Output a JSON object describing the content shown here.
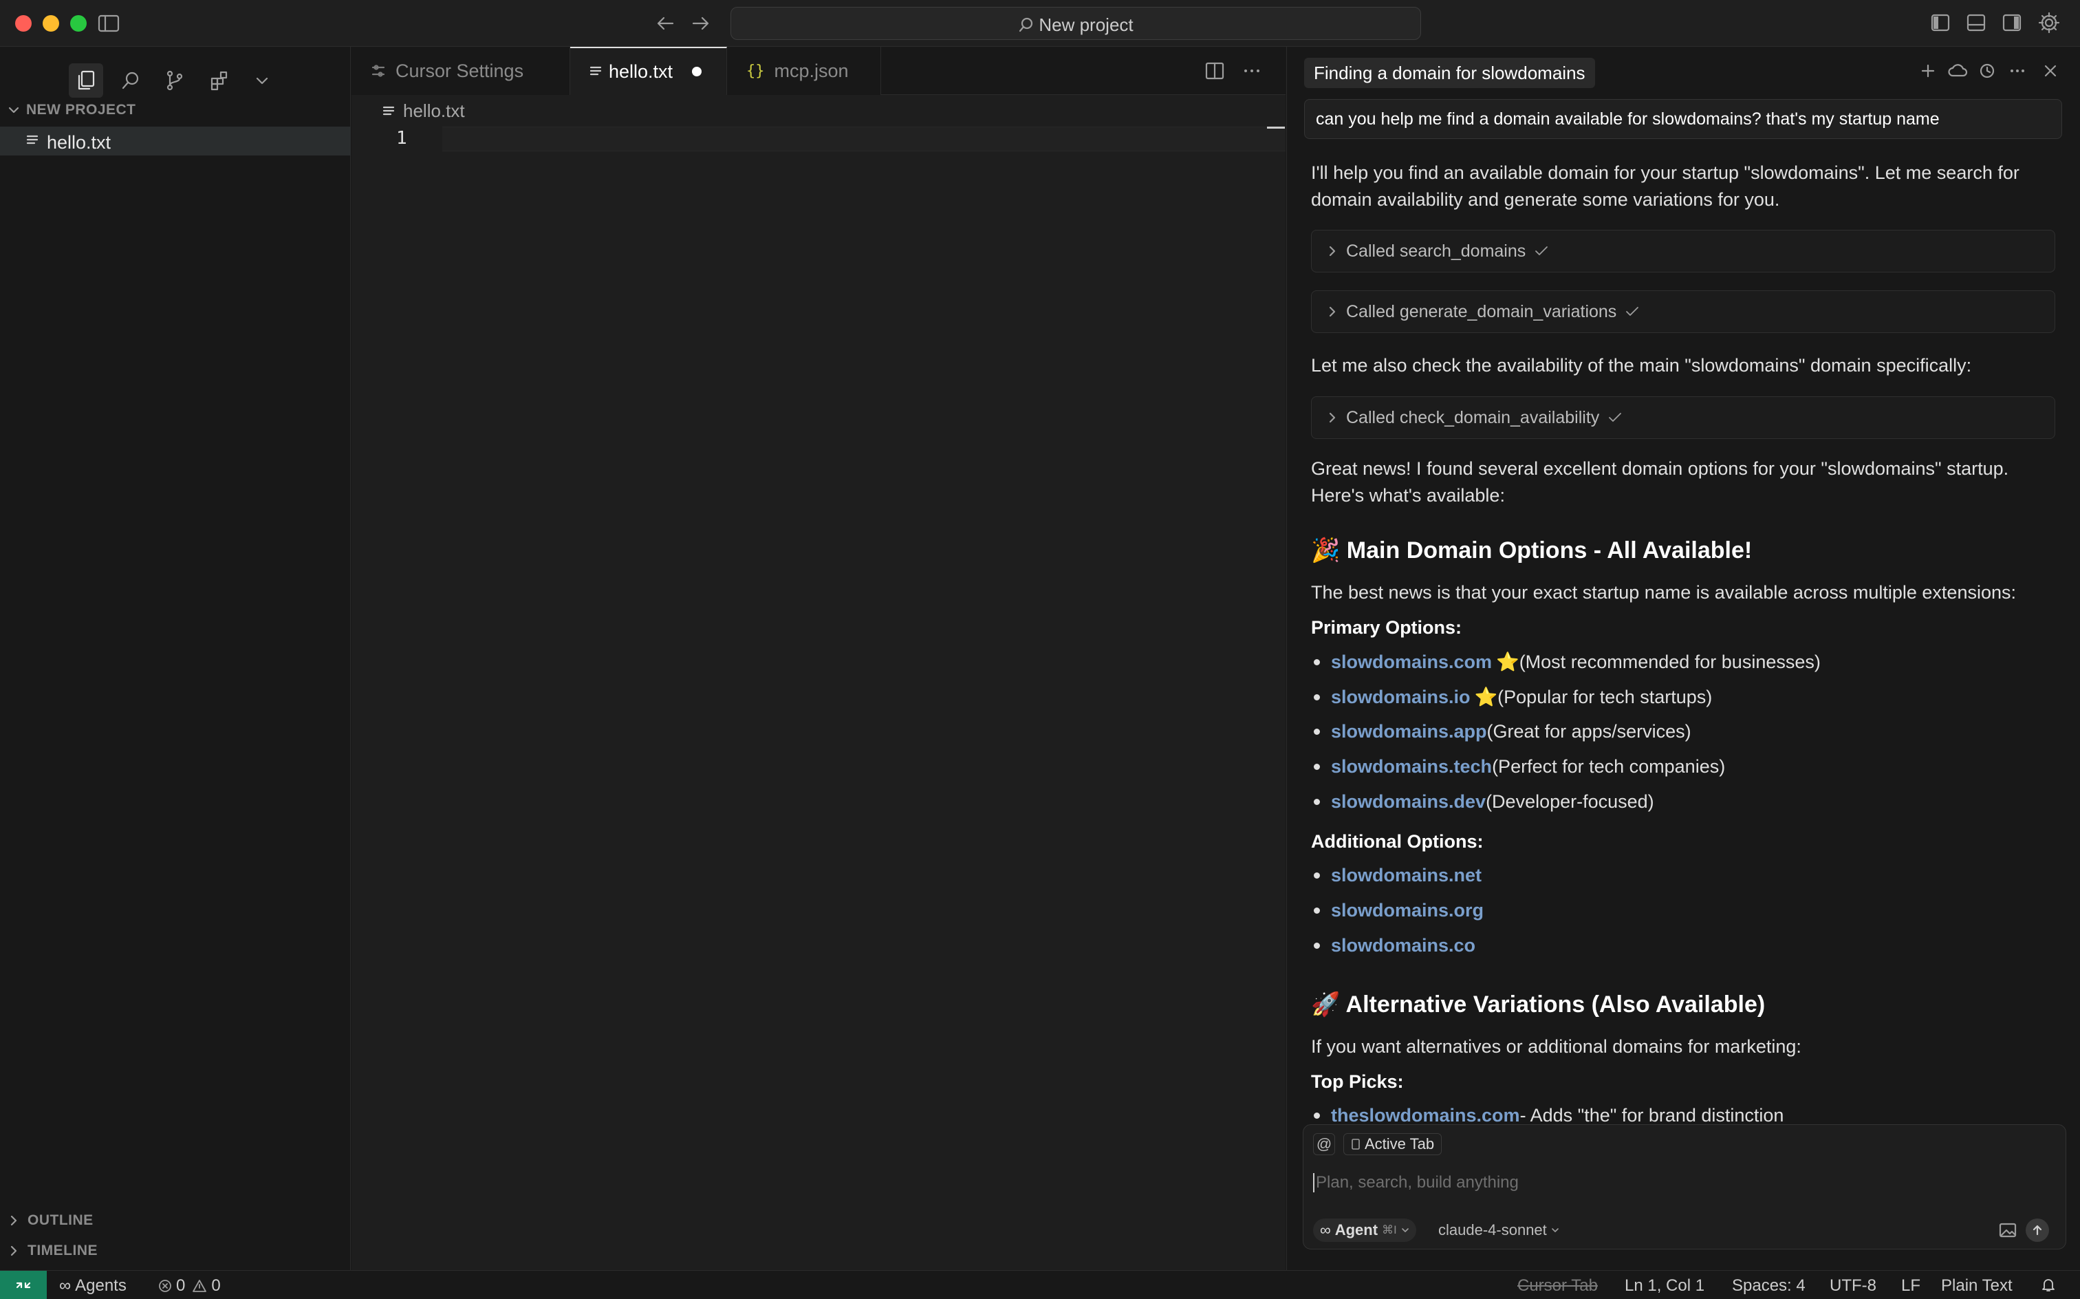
{
  "window": {
    "title": "New project"
  },
  "colors": {
    "accent": "#3794ff",
    "link": "#7a9fcc",
    "close": "#ff5f57",
    "minimize": "#febc2e",
    "zoom": "#28c840",
    "remote": "#16825d"
  },
  "sidebar": {
    "section_title": "NEW PROJECT",
    "files": [
      "hello.txt"
    ],
    "outline_label": "OUTLINE",
    "timeline_label": "TIMELINE"
  },
  "editor": {
    "tabs": [
      {
        "label": "Cursor Settings"
      },
      {
        "label": "hello.txt"
      },
      {
        "label": "mcp.json"
      }
    ],
    "breadcrumb": "hello.txt",
    "line_number": "1"
  },
  "agent": {
    "header_title": "Finding a domain for slowdomains",
    "user_message": "can you help me find a domain available for slowdomains? that's my startup name",
    "intro": "I'll help you find an available domain for your startup \"slowdomains\". Let me search for domain availability and generate some variations for you.",
    "calls": [
      "Called search_domains",
      "Called generate_domain_variations",
      "Called check_domain_availability"
    ],
    "check_main": "Let me also check the availability of the main \"slowdomains\" domain specifically:",
    "great_news": "Great news! I found several excellent domain options for your \"slowdomains\" startup. Here's what's available:",
    "heading_main": {
      "emoji": "🎉",
      "text": "Main Domain Options - All Available!"
    },
    "best_news": "The best news is that your exact startup name is available across multiple extensions:",
    "primary_label": "Primary Options:",
    "primary": [
      {
        "domain": "slowdomains.com",
        "star": "⭐",
        "note": " (Most recommended for businesses)"
      },
      {
        "domain": "slowdomains.io",
        "star": "⭐",
        "note": " (Popular for tech startups)"
      },
      {
        "domain": "slowdomains.app",
        "star": "",
        "note": " (Great for apps/services)"
      },
      {
        "domain": "slowdomains.tech",
        "star": "",
        "note": " (Perfect for tech companies)"
      },
      {
        "domain": "slowdomains.dev",
        "star": "",
        "note": " (Developer-focused)"
      }
    ],
    "additional_label": "Additional Options:",
    "additional": [
      "slowdomains.net",
      "slowdomains.org",
      "slowdomains.co"
    ],
    "heading_alt": {
      "emoji": "🚀",
      "text": "Alternative Variations (Also Available)"
    },
    "alt_intro": "If you want alternatives or additional domains for marketing:",
    "top_picks_label": "Top Picks:",
    "top_pick": {
      "domain": "theslowdomains.com",
      "note": " - Adds \"the\" for brand distinction"
    },
    "composer": {
      "at_symbol": "@",
      "context_chip": "Active Tab",
      "placeholder": "Plan, search, build anything",
      "mode_label": "Agent",
      "mode_shortcut": "⌘I",
      "model": "claude-4-sonnet"
    }
  },
  "statusbar": {
    "agents": "Agents",
    "errors": "0",
    "warnings": "0",
    "cursor_tab": "Cursor Tab",
    "position": "Ln 1, Col 1",
    "spaces": "Spaces: 4",
    "encoding": "UTF-8",
    "eol": "LF",
    "language": "Plain Text"
  }
}
